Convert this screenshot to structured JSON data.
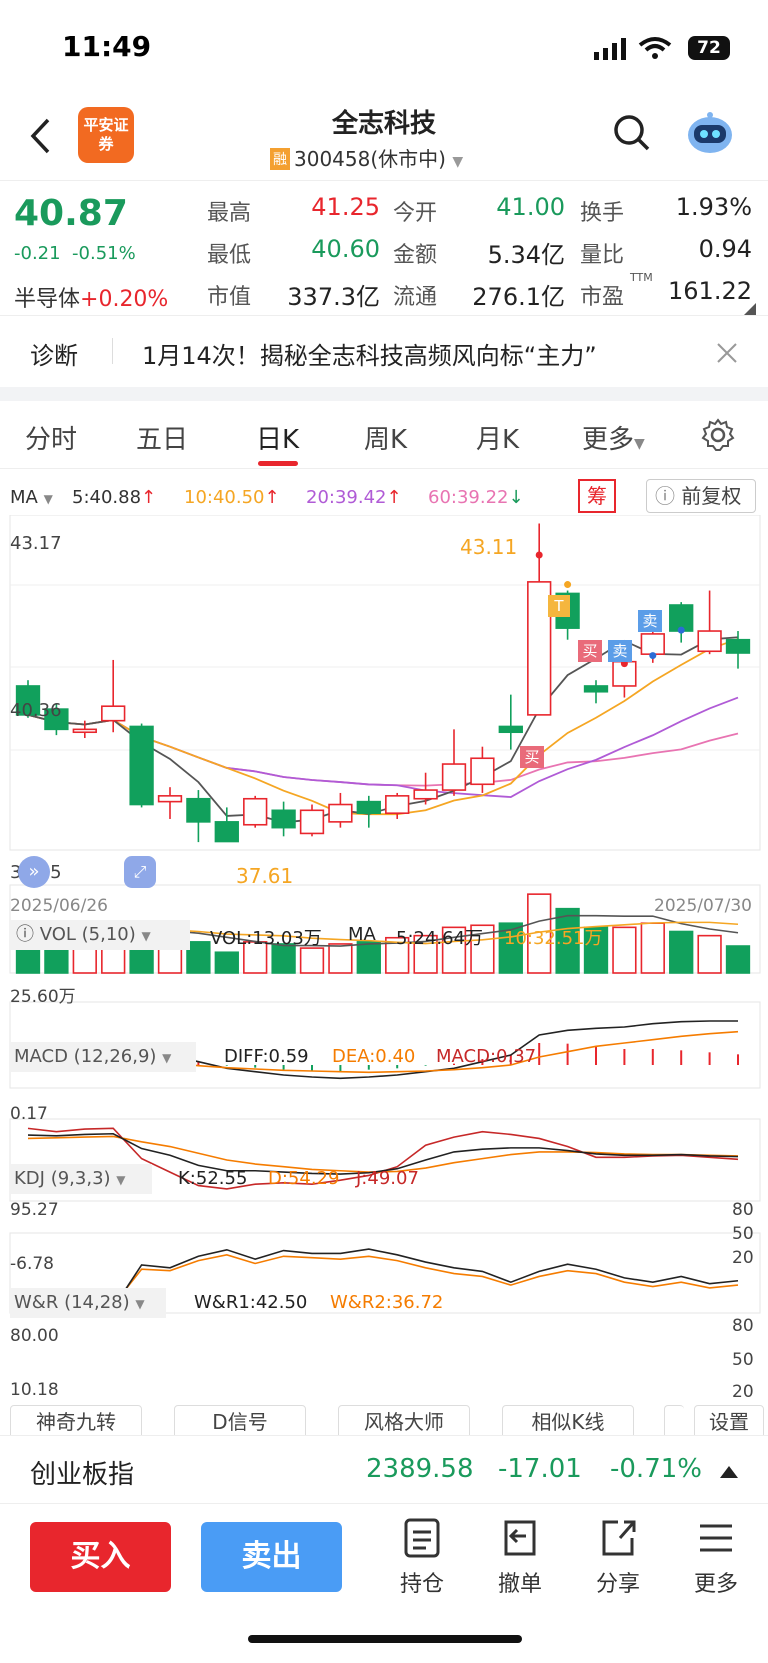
{
  "status": {
    "time": "11:49",
    "battery": "72"
  },
  "header": {
    "logo": "平安证券",
    "title": "全志科技",
    "rong": "融",
    "code": "300458(休市中)"
  },
  "quote": {
    "price": "40.87",
    "change": "-0.21",
    "change_pct": "-0.51%",
    "sector": "半导体",
    "sector_pct": "+0.20%",
    "high_label": "最高",
    "high": "41.25",
    "open_label": "今开",
    "open": "41.00",
    "turn_label": "换手",
    "turn": "1.93%",
    "low_label": "最低",
    "low": "40.60",
    "amount_label": "金额",
    "amount": "5.34亿",
    "vr_label": "量比",
    "vr": "0.94",
    "mcap_label": "市值",
    "mcap": "337.3亿",
    "float_label": "流通",
    "float": "276.1亿",
    "pe_label": "市盈",
    "pe_sup": "TTM",
    "pe": "161.22"
  },
  "diagnosis": {
    "label": "诊断",
    "text": "1月14次！揭秘全志科技高频风向标“主力”"
  },
  "tabs": [
    "分时",
    "五日",
    "日K",
    "周K",
    "月K",
    "更多"
  ],
  "ma": {
    "label": "MA",
    "ma5": "5:40.88",
    "ma10": "10:40.50",
    "ma20": "20:39.42",
    "ma60": "60:39.22",
    "chou": "筹",
    "fq": "前复权"
  },
  "kline": {
    "ymax": "43.17",
    "ymid": "40.36",
    "ymin": "37.55",
    "peak": "43.11",
    "trough": "37.61",
    "date_start": "2025/06/26",
    "date_end": "2025/07/30",
    "buy": "买",
    "sell": "卖",
    "t": "T"
  },
  "vol": {
    "label": "VOL (5,10)",
    "vol": "VOL:13.03万",
    "ma": "MA",
    "ma5": "5:24.64万",
    "ma10": "10:32.51万",
    "axis": "25.60万"
  },
  "macd": {
    "label": "MACD (12,26,9)",
    "diff": "DIFF:0.59",
    "dea": "DEA:0.40",
    "macd": "MACD:0.37",
    "axis": "0.17"
  },
  "kdj": {
    "label": "KDJ (9,3,3)",
    "k": "K:52.55",
    "d": "D:54.29",
    "j": "J:49.07",
    "top": "95.27",
    "bot": "-6.78",
    "r80": "80",
    "r50": "50",
    "r20": "20"
  },
  "wr": {
    "label": "W&R (14,28)",
    "wr1": "W&R1:42.50",
    "wr2": "W&R2:36.72",
    "top": "80.00",
    "bot": "10.18",
    "r80": "80",
    "r50": "50",
    "r20": "20"
  },
  "chips": [
    "神奇九转",
    "D信号",
    "风格大师",
    "相似K线",
    "设置"
  ],
  "index": {
    "name": "创业板指",
    "value": "2389.58",
    "change": "-17.01",
    "pct": "-0.71%"
  },
  "actions": {
    "buy": "买入",
    "sell": "卖出",
    "hold": "持仓",
    "cancel": "撤单",
    "share": "分享",
    "more": "更多"
  },
  "chart_data": {
    "type": "candlestick",
    "dates": [
      "2025/06/26",
      "2025/07/30"
    ],
    "candles": [
      [
        40.3,
        39.8,
        40.4,
        39.75
      ],
      [
        39.9,
        39.55,
        40.0,
        39.45
      ],
      [
        39.5,
        39.55,
        39.7,
        39.4
      ],
      [
        39.7,
        39.95,
        40.75,
        39.5
      ],
      [
        39.6,
        38.25,
        39.65,
        38.2
      ],
      [
        38.3,
        38.4,
        38.55,
        38.0
      ],
      [
        38.35,
        37.95,
        38.5,
        37.6
      ],
      [
        37.95,
        37.61,
        38.2,
        37.61
      ],
      [
        37.9,
        38.35,
        38.4,
        37.85
      ],
      [
        38.15,
        37.85,
        38.3,
        37.7
      ],
      [
        37.75,
        38.15,
        38.25,
        37.7
      ],
      [
        37.95,
        38.25,
        38.45,
        37.85
      ],
      [
        38.3,
        38.1,
        38.4,
        37.85
      ],
      [
        38.1,
        38.4,
        38.45,
        38.0
      ],
      [
        38.35,
        38.5,
        38.8,
        38.25
      ],
      [
        38.5,
        38.95,
        39.55,
        38.4
      ],
      [
        38.6,
        39.05,
        39.25,
        38.45
      ],
      [
        39.6,
        39.5,
        40.15,
        39.2
      ],
      [
        39.8,
        42.1,
        43.11,
        39.8
      ],
      [
        41.9,
        41.3,
        41.95,
        41.1
      ],
      [
        40.3,
        40.2,
        40.4,
        40.0
      ],
      [
        40.3,
        40.72,
        40.85,
        40.1
      ],
      [
        40.85,
        41.2,
        41.55,
        40.7
      ],
      [
        41.7,
        41.25,
        41.75,
        41.05
      ],
      [
        40.9,
        41.25,
        41.95,
        40.85
      ],
      [
        41.1,
        40.87,
        41.25,
        40.6
      ]
    ],
    "ma5_last": 40.88,
    "ma10_last": 40.5,
    "ma20_last": 39.42,
    "ma60_last": 39.22,
    "ylim": [
      37.55,
      43.17
    ]
  }
}
